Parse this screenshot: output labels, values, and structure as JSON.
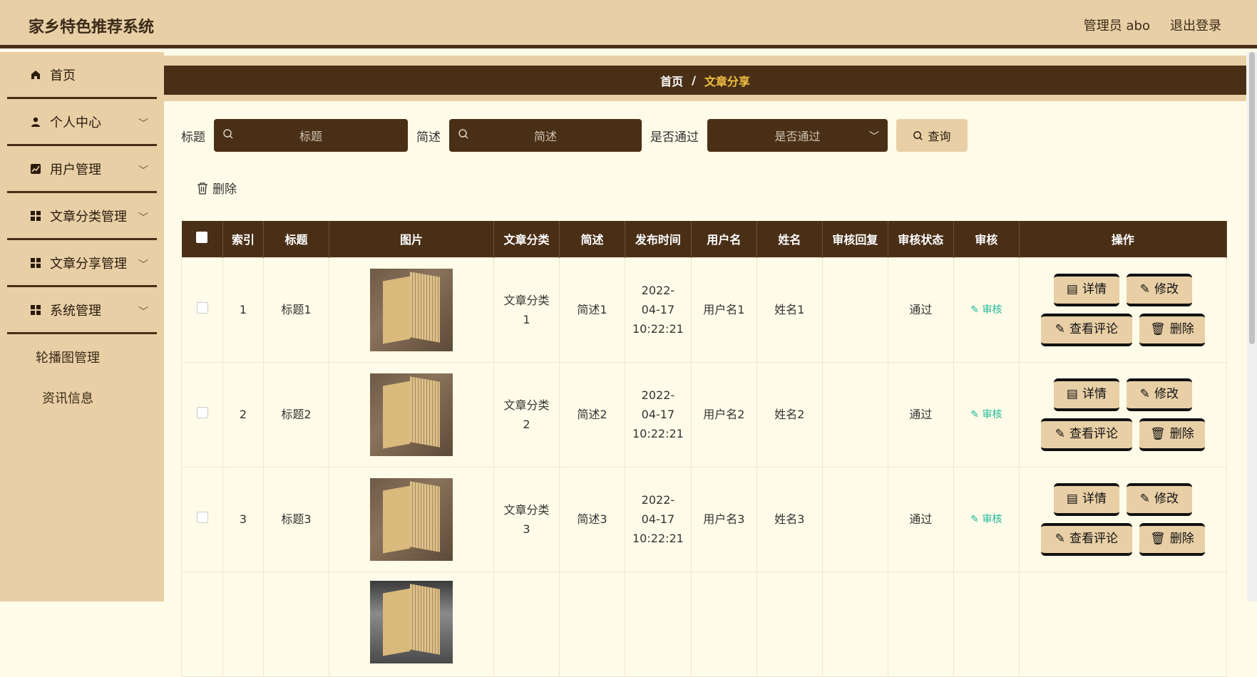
{
  "app": {
    "title": "家乡特色推荐系统",
    "user_label": "管理员 abo",
    "logout_label": "退出登录"
  },
  "sidebar": {
    "items": [
      {
        "label": "首页",
        "icon": "home-icon"
      },
      {
        "label": "个人中心",
        "icon": "user-icon"
      },
      {
        "label": "用户管理",
        "icon": "chart-icon"
      },
      {
        "label": "文章分类管理",
        "icon": "grid-icon"
      },
      {
        "label": "文章分享管理",
        "icon": "grid-icon"
      },
      {
        "label": "系统管理",
        "icon": "grid-icon"
      }
    ],
    "sub": [
      "轮播图管理",
      "资讯信息"
    ]
  },
  "breadcrumb": {
    "home": "首页",
    "sep": "/",
    "current": "文章分享"
  },
  "search": {
    "title_label": "标题",
    "title_placeholder": "标题",
    "brief_label": "简述",
    "brief_placeholder": "简述",
    "pass_label": "是否通过",
    "pass_placeholder": "是否通过",
    "query_label": "查询"
  },
  "toolbar": {
    "delete_label": "删除"
  },
  "table": {
    "headers": [
      "索引",
      "标题",
      "图片",
      "文章分类",
      "简述",
      "发布时间",
      "用户名",
      "姓名",
      "审核回复",
      "审核状态",
      "审核",
      "操作"
    ],
    "rows": [
      {
        "index": "1",
        "title": "标题1",
        "category": "文章分类1",
        "brief": "简述1",
        "time": "2022-04-17 10:22:21",
        "username": "用户名1",
        "name": "姓名1",
        "reply": "",
        "status": "通过"
      },
      {
        "index": "2",
        "title": "标题2",
        "category": "文章分类2",
        "brief": "简述2",
        "time": "2022-04-17 10:22:21",
        "username": "用户名2",
        "name": "姓名2",
        "reply": "",
        "status": "通过"
      },
      {
        "index": "3",
        "title": "标题3",
        "category": "文章分类3",
        "brief": "简述3",
        "time": "2022-04-17 10:22:21",
        "username": "用户名3",
        "name": "姓名3",
        "reply": "",
        "status": "通过"
      }
    ],
    "audit_label": "审核",
    "ops": {
      "detail": "详情",
      "edit": "修改",
      "comments": "查看评论",
      "delete": "删除"
    }
  }
}
